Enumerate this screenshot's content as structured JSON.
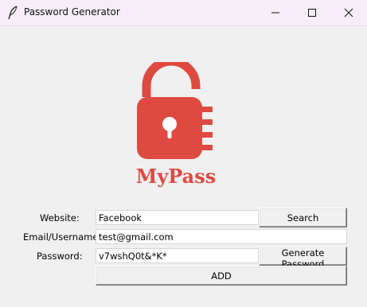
{
  "window": {
    "title": "Password Generator",
    "app_icon": "feather-icon",
    "controls": [
      "minimize-icon",
      "maximize-icon",
      "close-icon"
    ]
  },
  "logo": {
    "text": "MyPass",
    "icon": "unlocked-padlock-icon",
    "color": "#de4a41"
  },
  "form": {
    "website_label": "Website:",
    "website_value": "Facebook",
    "email_label": "Email/Username:",
    "email_value": "test@gmail.com",
    "password_label": "Password:",
    "password_value": "v7wshQ0t&*K*",
    "search_button": "Search",
    "generate_button": "Generate Password",
    "add_button": "ADD"
  }
}
